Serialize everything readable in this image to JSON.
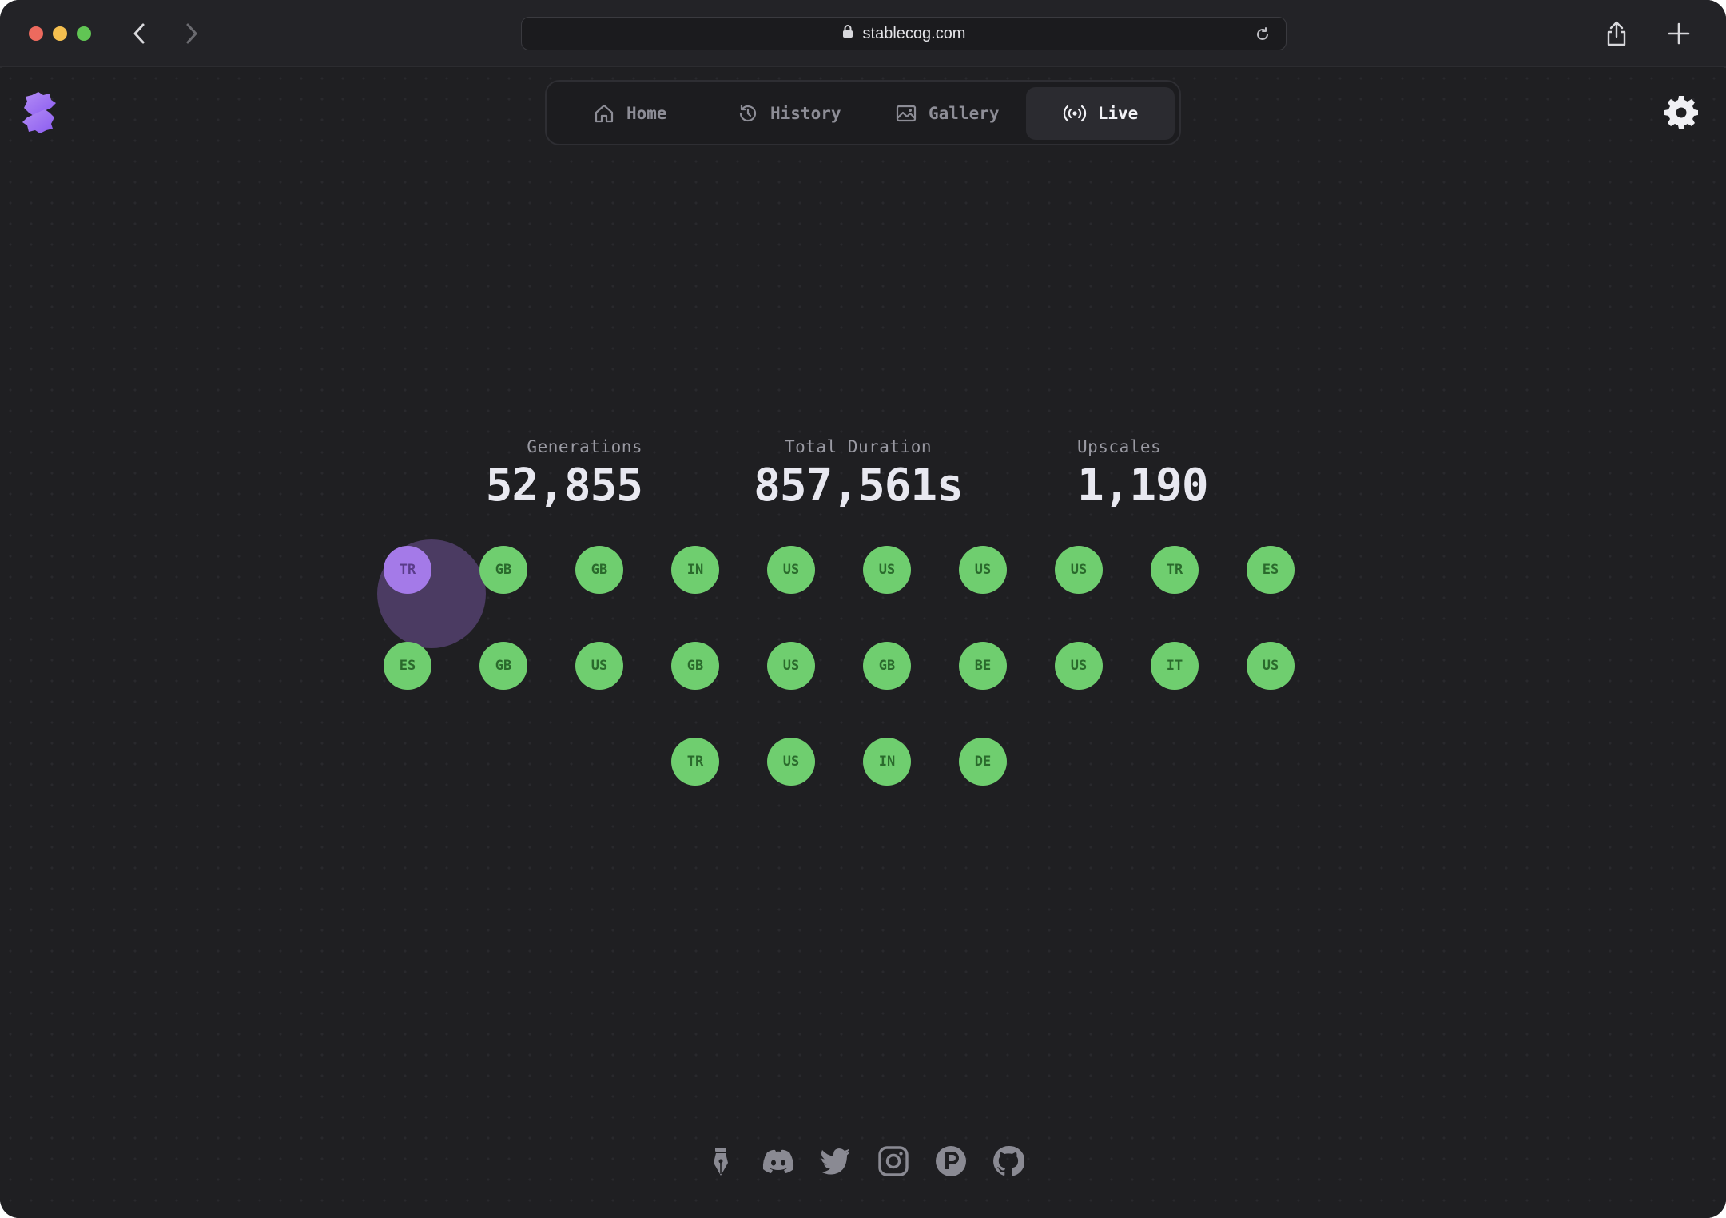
{
  "browser": {
    "url": "stablecog.com",
    "icons": [
      "back-icon",
      "forward-icon",
      "lock-icon",
      "reload-icon",
      "share-icon",
      "new-tab-icon"
    ]
  },
  "nav": {
    "items": [
      {
        "label": "Home",
        "icon": "home-icon"
      },
      {
        "label": "History",
        "icon": "history-icon"
      },
      {
        "label": "Gallery",
        "icon": "gallery-icon"
      },
      {
        "label": "Live",
        "icon": "live-icon",
        "active": true
      }
    ]
  },
  "stats": {
    "generations": {
      "label": "Generations",
      "value": "52,855"
    },
    "duration": {
      "label": "Total Duration",
      "value": "857,561s"
    },
    "upscales": {
      "label": "Upscales",
      "value": "1,190"
    }
  },
  "bubbles": {
    "rows": [
      [
        "TR",
        "GB",
        "GB",
        "IN",
        "US",
        "US",
        "US",
        "US",
        "TR",
        "ES"
      ],
      [
        "ES",
        "GB",
        "US",
        "GB",
        "US",
        "GB",
        "BE",
        "US",
        "IT",
        "US"
      ],
      [
        "TR",
        "US",
        "IN",
        "DE"
      ]
    ],
    "active": "TR",
    "colors": {
      "default": "#6fce6f",
      "active": "#a47ae8"
    }
  },
  "footer": {
    "icons": [
      "blog-pen-icon",
      "discord-icon",
      "twitter-icon",
      "instagram-icon",
      "producthunt-icon",
      "github-icon"
    ]
  }
}
